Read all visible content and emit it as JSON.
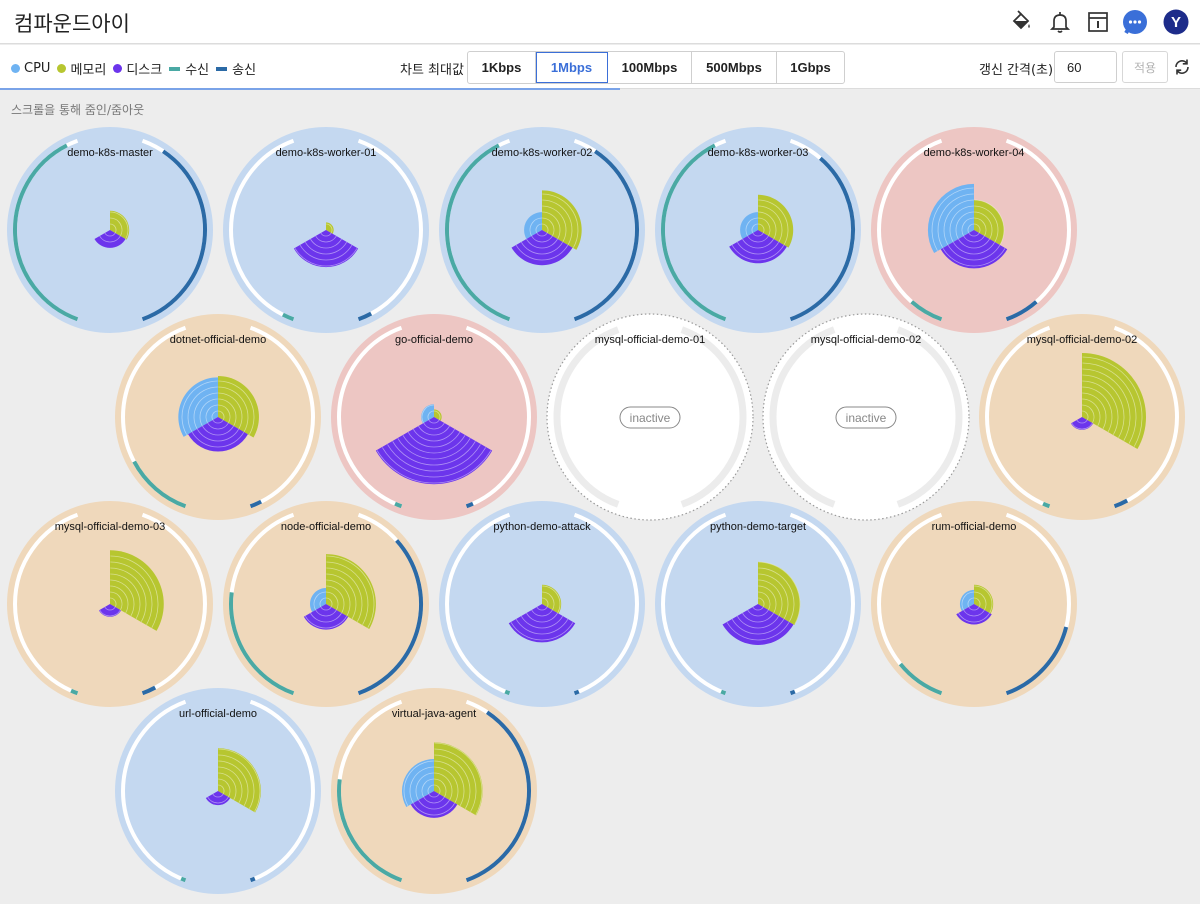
{
  "app": {
    "title": "컴파운드아이"
  },
  "header_icons": [
    "paint-bucket-icon",
    "bell-icon",
    "info-panel-icon",
    "chat-icon",
    "user-avatar-icon"
  ],
  "user": {
    "initial": "Y"
  },
  "legend": [
    {
      "label": "CPU",
      "color": "#6fb3f2",
      "kind": "dot"
    },
    {
      "label": "메모리",
      "color": "#b7c630",
      "kind": "dot"
    },
    {
      "label": "디스크",
      "color": "#6c35ec",
      "kind": "dot"
    },
    {
      "label": "수신",
      "color": "#4aa9a4",
      "kind": "bar"
    },
    {
      "label": "송신",
      "color": "#2b6aa6",
      "kind": "bar"
    }
  ],
  "chart_max": {
    "label": "차트 최대값",
    "options": [
      "1Kbps",
      "1Mbps",
      "100Mbps",
      "500Mbps",
      "1Gbps"
    ],
    "selected": "1Mbps"
  },
  "refresh": {
    "label": "갱신 간격(초)",
    "value": "60",
    "apply_label": "적용"
  },
  "hint": "스크롤을 통해 줌인/줌아웃",
  "colors": {
    "cpu": "#6fb3f2",
    "memory": "#b7c630",
    "disk": "#6c35ec",
    "rx": "#4aa9a4",
    "tx": "#2b6aa6",
    "bg_blue": "#c4d8f0",
    "bg_red": "#edc6c3",
    "bg_orange": "#efd8bb",
    "bg_inactive": "#ffffff"
  },
  "inactive_label": "inactive",
  "nodes": [
    {
      "name": "demo-k8s-master",
      "status": "blue",
      "cpu": 0,
      "mem": 0.3,
      "disk": 0.28,
      "rx": 0.95,
      "tx": 0.9
    },
    {
      "name": "demo-k8s-worker-01",
      "status": "blue",
      "cpu": 0,
      "mem": 0.12,
      "disk": 0.58,
      "rx": 0.05,
      "tx": 0.06
    },
    {
      "name": "demo-k8s-worker-02",
      "status": "blue",
      "cpu": 0.28,
      "mem": 0.62,
      "disk": 0.55,
      "rx": 0.95,
      "tx": 0.9
    },
    {
      "name": "demo-k8s-worker-03",
      "status": "blue",
      "cpu": 0.28,
      "mem": 0.55,
      "disk": 0.52,
      "rx": 0.95,
      "tx": 0.85
    },
    {
      "name": "demo-k8s-worker-04",
      "status": "red",
      "cpu": 0.72,
      "mem": 0.47,
      "disk": 0.6,
      "rx": 0.15,
      "tx": 0.15
    },
    {
      "name": "dotnet-official-demo",
      "status": "orange",
      "cpu": 0.62,
      "mem": 0.64,
      "disk": 0.54,
      "rx": 0.3,
      "tx": 0.05
    },
    {
      "name": "go-official-demo",
      "status": "red",
      "cpu": 0.2,
      "mem": 0.12,
      "disk": 1.05,
      "rx": 0.03,
      "tx": 0.03
    },
    {
      "name": "mysql-official-demo-01",
      "status": "inactive"
    },
    {
      "name": "mysql-official-demo-02",
      "status": "inactive"
    },
    {
      "name": "mysql-official-demo-02",
      "status": "orange",
      "cpu": 0,
      "mem": 1.0,
      "disk": 0.2,
      "rx": 0.03,
      "tx": 0.06
    },
    {
      "name": "mysql-official-demo-03",
      "status": "orange",
      "cpu": 0,
      "mem": 0.84,
      "disk": 0.2,
      "rx": 0.03,
      "tx": 0.06
    },
    {
      "name": "node-official-demo",
      "status": "orange",
      "cpu": 0.25,
      "mem": 0.78,
      "disk": 0.4,
      "rx": 0.55,
      "tx": 0.8
    },
    {
      "name": "python-demo-attack",
      "status": "blue",
      "cpu": 0,
      "mem": 0.3,
      "disk": 0.6,
      "rx": 0.02,
      "tx": 0.02
    },
    {
      "name": "python-demo-target",
      "status": "blue",
      "cpu": 0,
      "mem": 0.66,
      "disk": 0.64,
      "rx": 0.02,
      "tx": 0.02
    },
    {
      "name": "rum-official-demo",
      "status": "orange",
      "cpu": 0.22,
      "mem": 0.3,
      "disk": 0.32,
      "rx": 0.22,
      "tx": 0.4
    },
    {
      "name": "url-official-demo",
      "status": "blue",
      "cpu": 0,
      "mem": 0.67,
      "disk": 0.22,
      "rx": 0.02,
      "tx": 0.02
    },
    {
      "name": "virtual-java-agent",
      "status": "orange",
      "cpu": 0.5,
      "mem": 0.76,
      "disk": 0.42,
      "rx": 0.55,
      "tx": 0.9
    }
  ]
}
